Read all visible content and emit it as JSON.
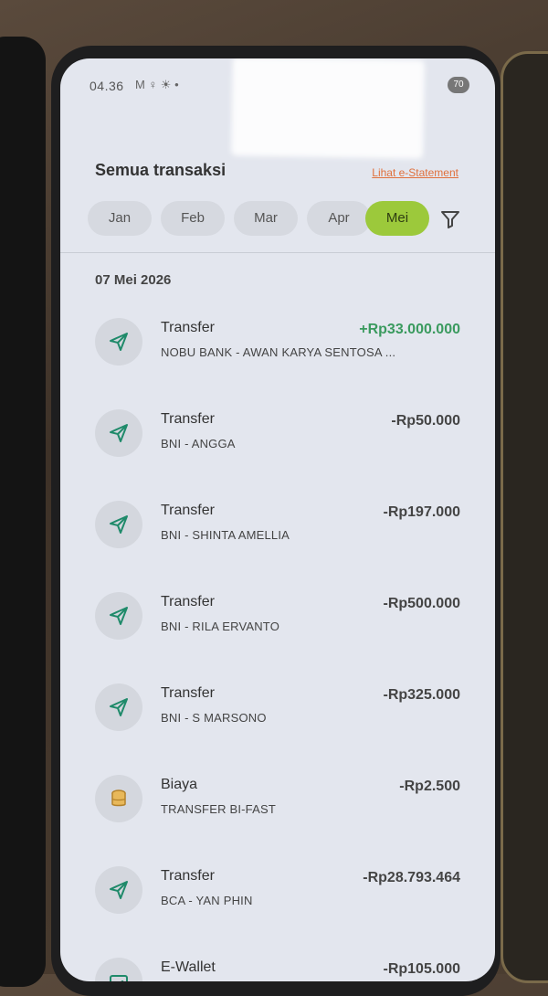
{
  "status": {
    "time": "04.36",
    "icons": "M ♀ ☀ •",
    "battery": "70"
  },
  "header": {
    "title": "Semua transaksi",
    "link": "Lihat e-Statement"
  },
  "months": [
    {
      "label": "Jan",
      "active": false
    },
    {
      "label": "Feb",
      "active": false
    },
    {
      "label": "Mar",
      "active": false
    },
    {
      "label": "Apr",
      "active": false
    },
    {
      "label": "Mei",
      "active": true
    }
  ],
  "date_group": "07 Mei 2026",
  "transactions": [
    {
      "type": "Transfer",
      "detail": "NOBU BANK - AWAN KARYA SENTOSA ...",
      "amount": "+Rp33.000.000",
      "positive": true,
      "icon": "send-icon"
    },
    {
      "type": "Transfer",
      "detail": "BNI - ANGGA",
      "amount": "-Rp50.000",
      "positive": false,
      "icon": "send-icon"
    },
    {
      "type": "Transfer",
      "detail": "BNI - SHINTA AMELLIA",
      "amount": "-Rp197.000",
      "positive": false,
      "icon": "send-icon"
    },
    {
      "type": "Transfer",
      "detail": "BNI - RILA ERVANTO",
      "amount": "-Rp500.000",
      "positive": false,
      "icon": "send-icon"
    },
    {
      "type": "Transfer",
      "detail": "BNI - S MARSONO",
      "amount": "-Rp325.000",
      "positive": false,
      "icon": "send-icon"
    },
    {
      "type": "Biaya",
      "detail": "TRANSFER BI-FAST",
      "amount": "-Rp2.500",
      "positive": false,
      "icon": "fee-icon"
    },
    {
      "type": "Transfer",
      "detail": "BCA - YAN PHIN",
      "amount": "-Rp28.793.464",
      "positive": false,
      "icon": "send-icon"
    },
    {
      "type": "E-Wallet",
      "detail": "",
      "amount": "-Rp105.000",
      "positive": false,
      "icon": "wallet-icon"
    }
  ],
  "colors": {
    "accent": "#9cc93b",
    "positive": "#3a9a5e",
    "link": "#e0703c",
    "icon": "#1f8a6a"
  }
}
